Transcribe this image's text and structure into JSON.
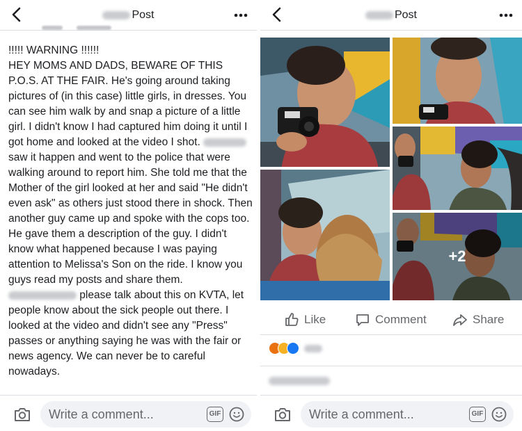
{
  "left": {
    "header": {
      "title": "Post"
    },
    "post": {
      "text_a": "!!!!! WARNING !!!!!!\nHEY MOMS AND DADS, BEWARE OF THIS P.O.S. AT THE FAIR. He's going around taking pictures of (in this case) little girls, in dresses. You can see him walk by and snap a picture of a little girl. I didn't know I had captured him doing it until I got home and looked at the video I shot. ",
      "text_b": " saw it happen and went to the police that were walking around to report him. She told me that the Mother of the girl looked at her and said \"He didn't even ask\" as others just stood there in shock. Then another guy came up and spoke with the cops too. He gave them a description of the guy. I didn't know what happened because I was paying attention to Melissa's Son on the ride. I know you guys read my posts and share them. ",
      "text_c": " please talk about this on KVTA, let people know about the sick people out there. I looked at the video and didn't see any \"Press\" passes or anything saying he was with the fair or news agency. We can never be to careful nowadays."
    },
    "comment_bar": {
      "placeholder": "Write a comment...",
      "gif_label": "GIF"
    }
  },
  "right": {
    "header": {
      "title": "Post"
    },
    "photos": {
      "more_count": "+2"
    },
    "actions": {
      "like": "Like",
      "comment": "Comment",
      "share": "Share"
    },
    "reactions": [
      "angry",
      "wow",
      "like"
    ],
    "comment_bar": {
      "placeholder": "Write a comment...",
      "gif_label": "GIF"
    }
  },
  "colors": {
    "text": "#1c1e21",
    "secondary": "#65676b",
    "input_bg": "#f0f2f5",
    "divider": "#dadde1",
    "like_blue": "#1877f2",
    "angry_orange": "#e9710f",
    "wow_yellow": "#f7b125"
  }
}
